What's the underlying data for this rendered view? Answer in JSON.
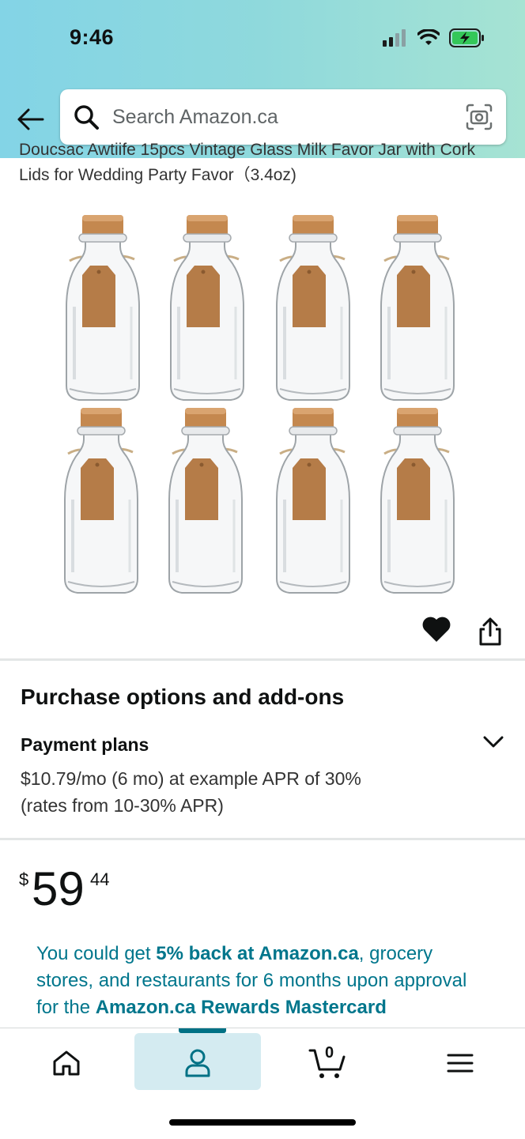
{
  "status_bar": {
    "time": "9:46"
  },
  "search": {
    "placeholder": "Search Amazon.ca"
  },
  "product": {
    "title_line1": "Doucsac Awtiife 15pcs Vintage Glass Milk Favor Jar with Cork",
    "title_line2": "Lids for Wedding Party Favor（3.4oz)"
  },
  "purchase_options": {
    "heading": "Purchase options and add-ons",
    "payment_plans_label": "Payment plans",
    "payment_plans_line1": "$10.79/mo (6 mo) at example APR of 30%",
    "payment_plans_line2": "(rates from 10-30% APR)"
  },
  "price": {
    "symbol": "$",
    "whole": "59",
    "fraction": "44"
  },
  "promo": {
    "part1": "You could get ",
    "bold1": "5% back at Amazon.ca",
    "part2": ", grocery stores, and restaurants for 6 months upon approval for the ",
    "bold2": "Amazon.ca Rewards",
    "part3": " Mastercard"
  },
  "bottom_nav": {
    "cart_count": "0",
    "active": "account"
  },
  "colors": {
    "header_gradient_start": "#83d4e6",
    "header_gradient_end": "#a6e3d3",
    "link_teal": "#00768c",
    "nav_active_bg": "#d4ebf1"
  }
}
